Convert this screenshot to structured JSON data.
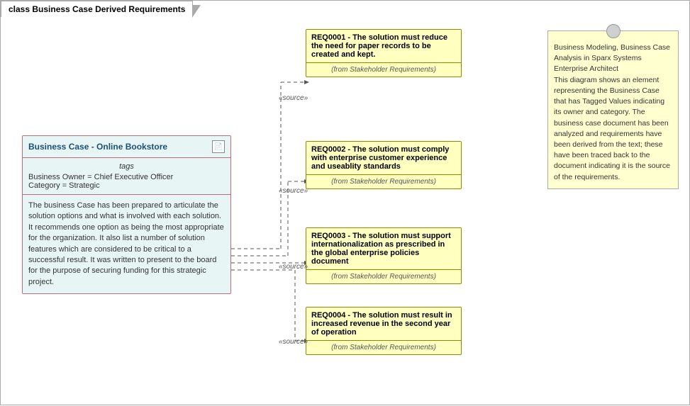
{
  "title": "class Business Case Derived Requirements",
  "businessCase": {
    "name": "Business Case - Online Bookstore",
    "tagsLabel": "tags",
    "tag1": "Business Owner = Chief Executive Officer",
    "tag2": "Category = Strategic",
    "body": "The business Case has been prepared to articulate the solution options and what is involved with each solution. It recommends one option as being the most appropriate for the organization. It also list a number of solution features which are considered to be critical to a successful result. It was written to present to the board for the purpose of securing funding for this strategic project."
  },
  "requirements": [
    {
      "id": "req1",
      "header": "REQ0001 - The solution must reduce the need for paper records to be created and kept.",
      "from": "(from Stakeholder Requirements)"
    },
    {
      "id": "req2",
      "header": "REQ0002 - The solution must comply with enterprise customer experience and useablity standards",
      "from": "(from Stakeholder Requirements)"
    },
    {
      "id": "req3",
      "header": "REQ0003 - The solution must support internationalization as prescribed in the global enterprise policies document",
      "from": "(from Stakeholder Requirements)"
    },
    {
      "id": "req4",
      "header": "REQ0004 - The solution must result in increased revenue in the second year of operation",
      "from": "(from Stakeholder Requirements)"
    }
  ],
  "note": {
    "text": "Business Modeling, Business Case Analysis in Sparx Systems Enterprise Architect\nThis diagram shows an element representing the Business Case that has Tagged Values indicating its owner and category. The business case document has been analyzed and requirements have been derived from the text; these have been traced back to the document indicating it is the source of the requirements."
  },
  "sourceLabel": "«source»"
}
